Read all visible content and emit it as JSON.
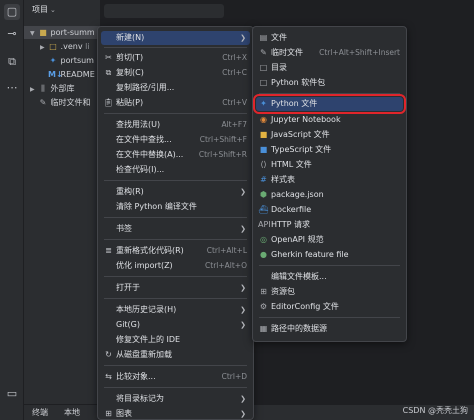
{
  "project_panel": {
    "title": "项目",
    "tree": [
      {
        "label": "port-summ",
        "icon": "folder-icon"
      },
      {
        "label": ".venv",
        "suffix": "li",
        "icon": "folder-icon"
      },
      {
        "label": "portsum",
        "icon": "python-file-icon"
      },
      {
        "label": "README",
        "icon": "markdown-icon"
      },
      {
        "label": "外部库",
        "icon": "library-icon"
      },
      {
        "label": "临时文件和",
        "icon": "scratch-icon"
      }
    ]
  },
  "bottom_tabs": [
    "终端",
    "本地"
  ],
  "context_menu": {
    "items": [
      {
        "label": "新建(N)",
        "shortcut": "",
        "submenu": true
      },
      {
        "label": "剪切(T)",
        "shortcut": "Ctrl+X"
      },
      {
        "label": "复制(C)",
        "shortcut": "Ctrl+C"
      },
      {
        "label": "复制路径/引用...",
        "shortcut": ""
      },
      {
        "label": "粘贴(P)",
        "shortcut": "Ctrl+V"
      },
      {
        "label": "查找用法(U)",
        "shortcut": "Alt+F7"
      },
      {
        "label": "在文件中查找...",
        "shortcut": "Ctrl+Shift+F"
      },
      {
        "label": "在文件中替换(A)...",
        "shortcut": "Ctrl+Shift+R"
      },
      {
        "label": "检查代码(I)...",
        "shortcut": ""
      },
      {
        "label": "重构(R)",
        "shortcut": "",
        "submenu": true
      },
      {
        "label": "清除 Python 编译文件",
        "shortcut": ""
      },
      {
        "label": "书签",
        "shortcut": "",
        "submenu": true
      },
      {
        "label": "重新格式化代码(R)",
        "shortcut": "Ctrl+Alt+L"
      },
      {
        "label": "优化 import(Z)",
        "shortcut": "Ctrl+Alt+O"
      },
      {
        "label": "打开于",
        "shortcut": "",
        "submenu": true
      },
      {
        "label": "本地历史记录(H)",
        "shortcut": "",
        "submenu": true
      },
      {
        "label": "Git(G)",
        "shortcut": "",
        "submenu": true
      },
      {
        "label": "修复文件上的 IDE",
        "shortcut": ""
      },
      {
        "label": "从磁盘重新加载",
        "shortcut": ""
      },
      {
        "label": "比较对象...",
        "shortcut": "Ctrl+D"
      },
      {
        "label": "将目录标记为",
        "shortcut": "",
        "submenu": true
      },
      {
        "label": "图表",
        "shortcut": "",
        "submenu": true
      }
    ]
  },
  "new_submenu": {
    "items": [
      {
        "label": "文件",
        "shortcut": ""
      },
      {
        "label": "临时文件",
        "shortcut": "Ctrl+Alt+Shift+Insert"
      },
      {
        "label": "目录",
        "shortcut": ""
      },
      {
        "label": "Python 软件包",
        "shortcut": ""
      },
      {
        "label": "Python 文件",
        "shortcut": ""
      },
      {
        "label": "Jupyter Notebook",
        "shortcut": ""
      },
      {
        "label": "JavaScript 文件",
        "shortcut": ""
      },
      {
        "label": "TypeScript 文件",
        "shortcut": ""
      },
      {
        "label": "HTML 文件",
        "shortcut": ""
      },
      {
        "label": "样式表",
        "shortcut": ""
      },
      {
        "label": "package.json",
        "shortcut": ""
      },
      {
        "label": "Dockerfile",
        "shortcut": ""
      },
      {
        "label": "HTTP 请求",
        "shortcut": ""
      },
      {
        "label": "OpenAPI 规范",
        "shortcut": ""
      },
      {
        "label": "Gherkin feature file",
        "shortcut": ""
      },
      {
        "label": "编辑文件模板...",
        "shortcut": ""
      },
      {
        "label": "资源包",
        "shortcut": ""
      },
      {
        "label": "EditorConfig 文件",
        "shortcut": ""
      },
      {
        "label": "路径中的数据源",
        "shortcut": ""
      }
    ]
  },
  "watermark": "CSDN @秃秃土狗",
  "colors": {
    "highlight": "#2e436e",
    "red_box": "#e0252b",
    "menu_bg": "#2b2d30"
  }
}
